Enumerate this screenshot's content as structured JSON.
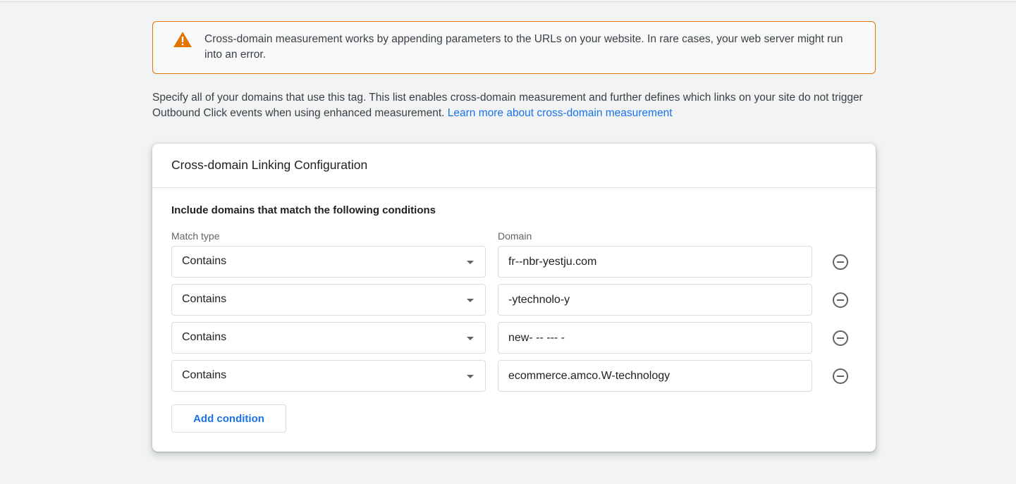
{
  "warning": {
    "text": "Cross-domain measurement works by appending parameters to the URLs on your website. In rare cases, your web server might run into an error.",
    "icon": "warning-triangle-icon",
    "color": "#e37400"
  },
  "intro": {
    "text": "Specify all of your domains that use this tag. This list enables cross-domain measurement and further defines which links on your site do not trigger Outbound Click events when using enhanced measurement. ",
    "link": "Learn more about cross-domain measurement"
  },
  "card": {
    "title": "Cross-domain Linking Configuration",
    "section_title": "Include domains that match the following conditions",
    "match_type_label": "Match type",
    "domain_label": "Domain",
    "rows": [
      {
        "match_type": "Contains",
        "domain": "fr--nbr-yestju.com"
      },
      {
        "match_type": "Contains",
        "domain": "-ytechnolo-y"
      },
      {
        "match_type": "Contains",
        "domain": "new- -- --- -"
      },
      {
        "match_type": "Contains",
        "domain": "ecommerce.amco.W-technology"
      }
    ],
    "add_condition_label": "Add condition"
  },
  "colors": {
    "accent": "#1a73e8",
    "warning": "#e37400",
    "background": "#f1f3f4"
  }
}
